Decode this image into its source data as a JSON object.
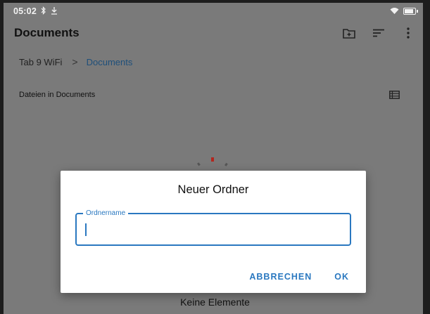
{
  "status_bar": {
    "time": "05:02",
    "bluetooth_icon": "bluetooth-icon",
    "download_icon": "download-icon",
    "wifi_icon": "wifi-icon",
    "battery_icon": "battery-icon"
  },
  "app_bar": {
    "title": "Documents",
    "actions": [
      "new-folder-icon",
      "sort-icon",
      "more-vert-icon"
    ]
  },
  "breadcrumb": {
    "root": "Tab 9 WiFi",
    "separator": ">",
    "current": "Documents"
  },
  "section": {
    "label": "Dateien in Documents",
    "view_icon": "list-view-icon"
  },
  "empty_state": {
    "label": "Keine Elemente"
  },
  "dialog": {
    "title": "Neuer Ordner",
    "field_label": "Ordnername",
    "field_value": "",
    "cancel_label": "ABBRECHEN",
    "ok_label": "OK"
  },
  "colors": {
    "accent": "#2a78c0",
    "scrim": "#7a7a7a",
    "spinner_red": "#b3261e"
  }
}
